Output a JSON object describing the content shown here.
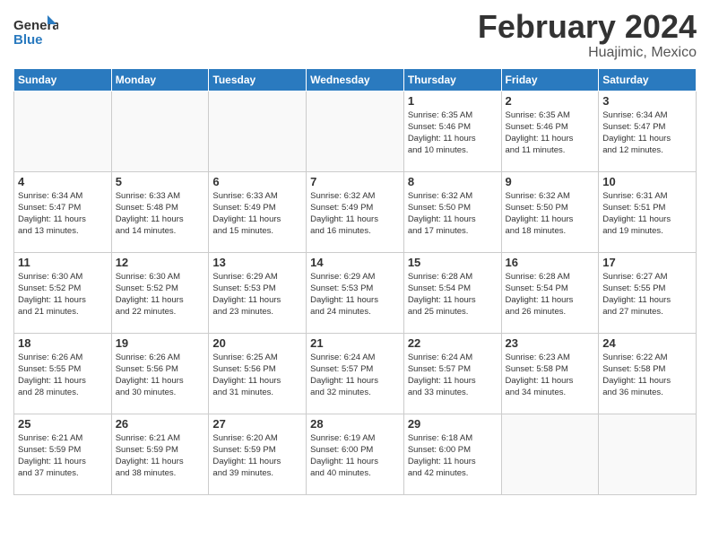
{
  "header": {
    "logo_text_general": "General",
    "logo_text_blue": "Blue",
    "month_title": "February 2024",
    "location": "Huajimic, Mexico"
  },
  "calendar": {
    "days_of_week": [
      "Sunday",
      "Monday",
      "Tuesday",
      "Wednesday",
      "Thursday",
      "Friday",
      "Saturday"
    ],
    "weeks": [
      [
        {
          "day": "",
          "info": ""
        },
        {
          "day": "",
          "info": ""
        },
        {
          "day": "",
          "info": ""
        },
        {
          "day": "",
          "info": ""
        },
        {
          "day": "1",
          "info": "Sunrise: 6:35 AM\nSunset: 5:46 PM\nDaylight: 11 hours\nand 10 minutes."
        },
        {
          "day": "2",
          "info": "Sunrise: 6:35 AM\nSunset: 5:46 PM\nDaylight: 11 hours\nand 11 minutes."
        },
        {
          "day": "3",
          "info": "Sunrise: 6:34 AM\nSunset: 5:47 PM\nDaylight: 11 hours\nand 12 minutes."
        }
      ],
      [
        {
          "day": "4",
          "info": "Sunrise: 6:34 AM\nSunset: 5:47 PM\nDaylight: 11 hours\nand 13 minutes."
        },
        {
          "day": "5",
          "info": "Sunrise: 6:33 AM\nSunset: 5:48 PM\nDaylight: 11 hours\nand 14 minutes."
        },
        {
          "day": "6",
          "info": "Sunrise: 6:33 AM\nSunset: 5:49 PM\nDaylight: 11 hours\nand 15 minutes."
        },
        {
          "day": "7",
          "info": "Sunrise: 6:32 AM\nSunset: 5:49 PM\nDaylight: 11 hours\nand 16 minutes."
        },
        {
          "day": "8",
          "info": "Sunrise: 6:32 AM\nSunset: 5:50 PM\nDaylight: 11 hours\nand 17 minutes."
        },
        {
          "day": "9",
          "info": "Sunrise: 6:32 AM\nSunset: 5:50 PM\nDaylight: 11 hours\nand 18 minutes."
        },
        {
          "day": "10",
          "info": "Sunrise: 6:31 AM\nSunset: 5:51 PM\nDaylight: 11 hours\nand 19 minutes."
        }
      ],
      [
        {
          "day": "11",
          "info": "Sunrise: 6:30 AM\nSunset: 5:52 PM\nDaylight: 11 hours\nand 21 minutes."
        },
        {
          "day": "12",
          "info": "Sunrise: 6:30 AM\nSunset: 5:52 PM\nDaylight: 11 hours\nand 22 minutes."
        },
        {
          "day": "13",
          "info": "Sunrise: 6:29 AM\nSunset: 5:53 PM\nDaylight: 11 hours\nand 23 minutes."
        },
        {
          "day": "14",
          "info": "Sunrise: 6:29 AM\nSunset: 5:53 PM\nDaylight: 11 hours\nand 24 minutes."
        },
        {
          "day": "15",
          "info": "Sunrise: 6:28 AM\nSunset: 5:54 PM\nDaylight: 11 hours\nand 25 minutes."
        },
        {
          "day": "16",
          "info": "Sunrise: 6:28 AM\nSunset: 5:54 PM\nDaylight: 11 hours\nand 26 minutes."
        },
        {
          "day": "17",
          "info": "Sunrise: 6:27 AM\nSunset: 5:55 PM\nDaylight: 11 hours\nand 27 minutes."
        }
      ],
      [
        {
          "day": "18",
          "info": "Sunrise: 6:26 AM\nSunset: 5:55 PM\nDaylight: 11 hours\nand 28 minutes."
        },
        {
          "day": "19",
          "info": "Sunrise: 6:26 AM\nSunset: 5:56 PM\nDaylight: 11 hours\nand 30 minutes."
        },
        {
          "day": "20",
          "info": "Sunrise: 6:25 AM\nSunset: 5:56 PM\nDaylight: 11 hours\nand 31 minutes."
        },
        {
          "day": "21",
          "info": "Sunrise: 6:24 AM\nSunset: 5:57 PM\nDaylight: 11 hours\nand 32 minutes."
        },
        {
          "day": "22",
          "info": "Sunrise: 6:24 AM\nSunset: 5:57 PM\nDaylight: 11 hours\nand 33 minutes."
        },
        {
          "day": "23",
          "info": "Sunrise: 6:23 AM\nSunset: 5:58 PM\nDaylight: 11 hours\nand 34 minutes."
        },
        {
          "day": "24",
          "info": "Sunrise: 6:22 AM\nSunset: 5:58 PM\nDaylight: 11 hours\nand 36 minutes."
        }
      ],
      [
        {
          "day": "25",
          "info": "Sunrise: 6:21 AM\nSunset: 5:59 PM\nDaylight: 11 hours\nand 37 minutes."
        },
        {
          "day": "26",
          "info": "Sunrise: 6:21 AM\nSunset: 5:59 PM\nDaylight: 11 hours\nand 38 minutes."
        },
        {
          "day": "27",
          "info": "Sunrise: 6:20 AM\nSunset: 5:59 PM\nDaylight: 11 hours\nand 39 minutes."
        },
        {
          "day": "28",
          "info": "Sunrise: 6:19 AM\nSunset: 6:00 PM\nDaylight: 11 hours\nand 40 minutes."
        },
        {
          "day": "29",
          "info": "Sunrise: 6:18 AM\nSunset: 6:00 PM\nDaylight: 11 hours\nand 42 minutes."
        },
        {
          "day": "",
          "info": ""
        },
        {
          "day": "",
          "info": ""
        }
      ]
    ]
  }
}
